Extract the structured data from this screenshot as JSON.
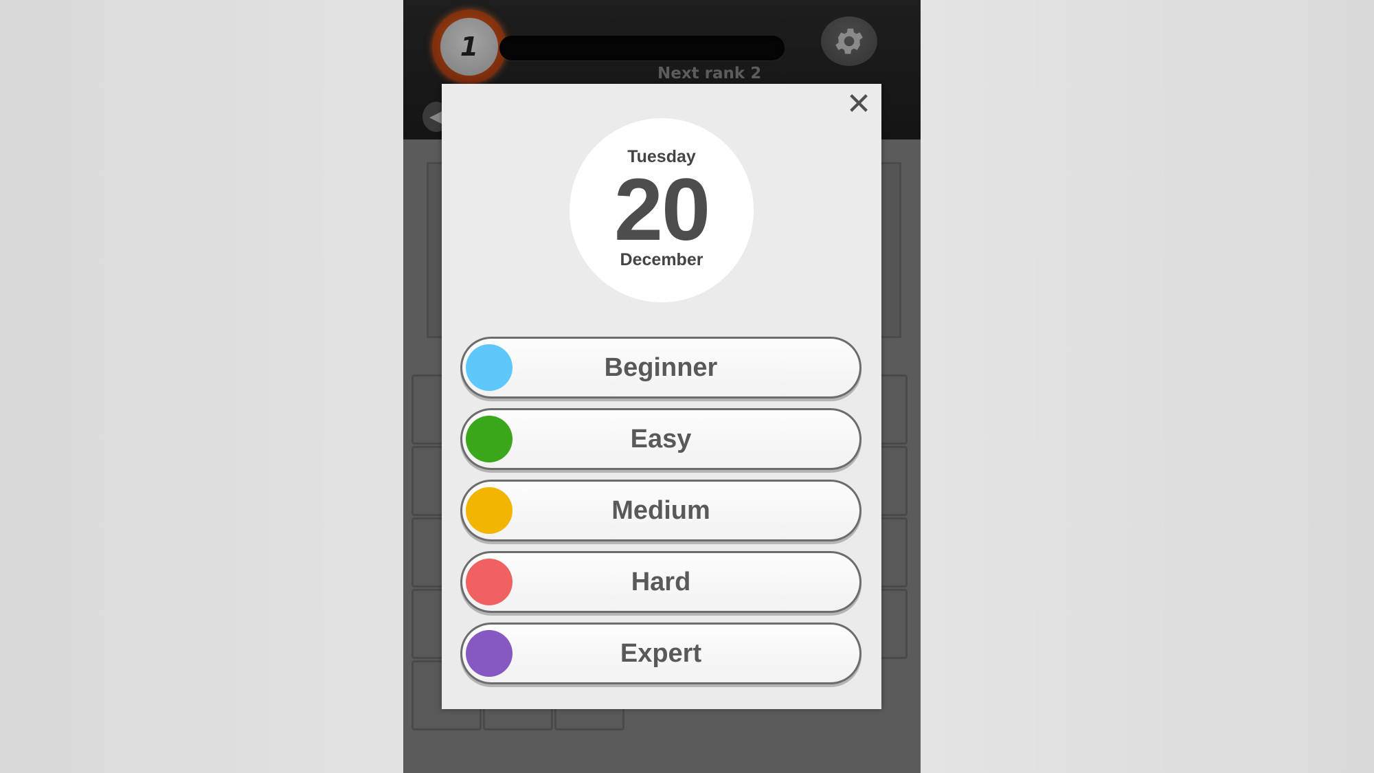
{
  "header": {
    "rank_number": "1",
    "next_rank_label": "Next rank 2",
    "settings_icon": "gear-icon",
    "back_icon": "arrow-left-icon"
  },
  "modal": {
    "close_label": "✕",
    "date": {
      "weekday": "Tuesday",
      "day": "20",
      "month": "December"
    },
    "levels": [
      {
        "label": "Beginner",
        "color": "#5ec8fb"
      },
      {
        "label": "Easy",
        "color": "#3aa81a"
      },
      {
        "label": "Medium",
        "color": "#f2b500"
      },
      {
        "label": "Hard",
        "color": "#f06262"
      },
      {
        "label": "Expert",
        "color": "#8558c2"
      }
    ]
  },
  "colors": {
    "modal_background": "#ebebeb",
    "topbar": "#1a1a1a",
    "rank_ring": "#b04a18"
  }
}
